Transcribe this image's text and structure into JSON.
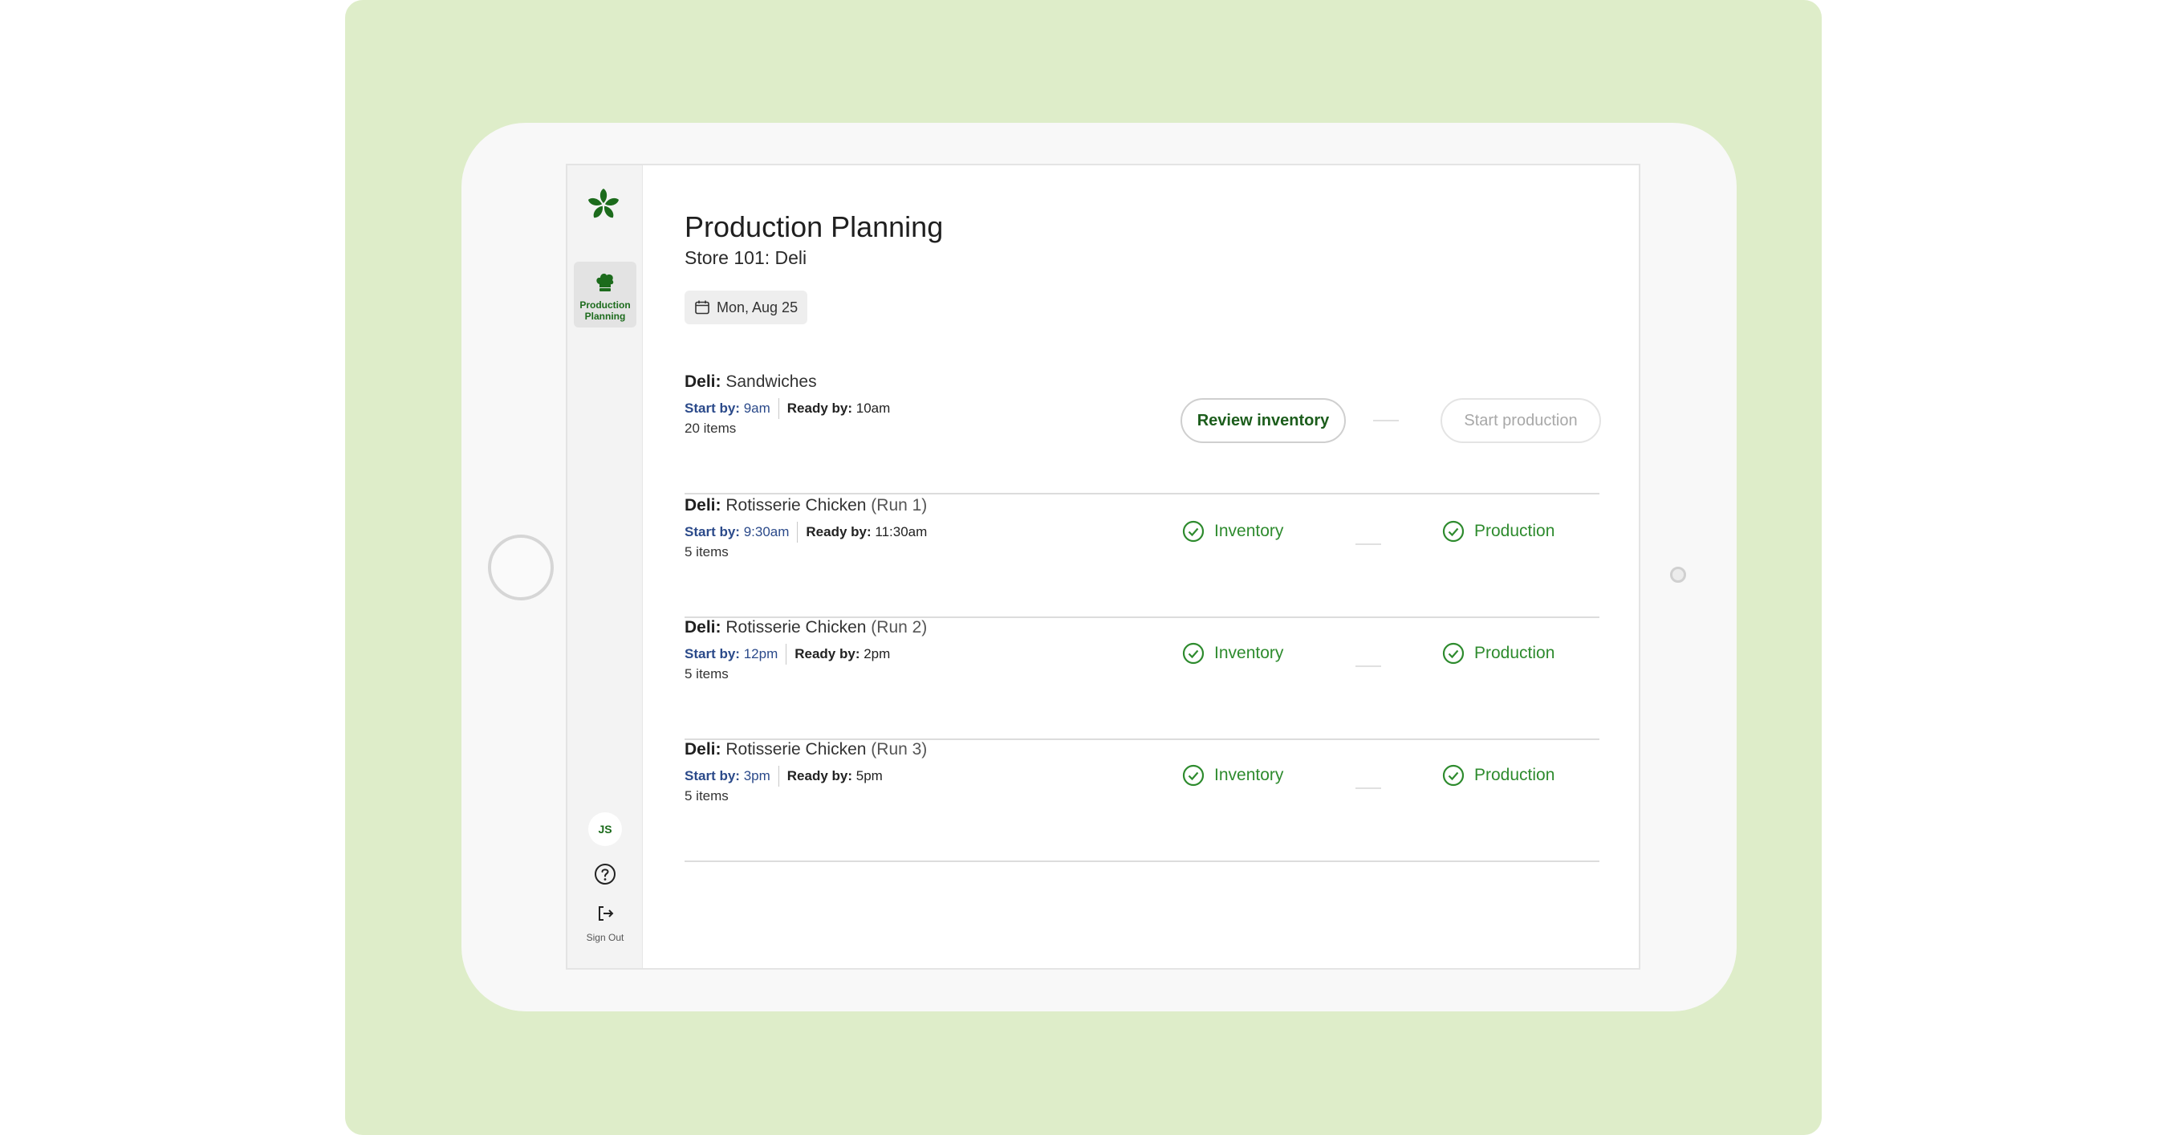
{
  "sidebar": {
    "nav_item": {
      "label": "Production Planning",
      "icon": "chef-hat-icon"
    },
    "user_initials": "JS",
    "sign_out_label": "Sign Out"
  },
  "header": {
    "title": "Production Planning",
    "subtitle": "Store 101: Deli",
    "date": "Mon, Aug 25"
  },
  "rows": [
    {
      "department": "Deli:",
      "name": "Sandwiches",
      "run": "",
      "start_label": "Start by:",
      "start_time": "9am",
      "ready_label": "Ready by:",
      "ready_time": "10am",
      "items": "20 items",
      "review_button": "Review inventory",
      "start_button": "Start production"
    },
    {
      "department": "Deli:",
      "name": "Rotisserie Chicken",
      "run": "(Run 1)",
      "start_label": "Start by:",
      "start_time": "9:30am",
      "ready_label": "Ready by:",
      "ready_time": "11:30am",
      "items": "5 items",
      "inventory_status": "Inventory",
      "production_status": "Production"
    },
    {
      "department": "Deli:",
      "name": "Rotisserie Chicken",
      "run": "(Run 2)",
      "start_label": "Start by:",
      "start_time": "12pm",
      "ready_label": "Ready by:",
      "ready_time": "2pm",
      "items": "5 items",
      "inventory_status": "Inventory",
      "production_status": "Production"
    },
    {
      "department": "Deli:",
      "name": "Rotisserie Chicken",
      "run": "(Run 3)",
      "start_label": "Start by:",
      "start_time": "3pm",
      "ready_label": "Ready by:",
      "ready_time": "5pm",
      "items": "5 items",
      "inventory_status": "Inventory",
      "production_status": "Production"
    }
  ],
  "colors": {
    "brand_green": "#1c6b1c",
    "status_green": "#2e8b2e",
    "start_blue": "#2b4a8a",
    "backdrop": "#deedc9"
  }
}
